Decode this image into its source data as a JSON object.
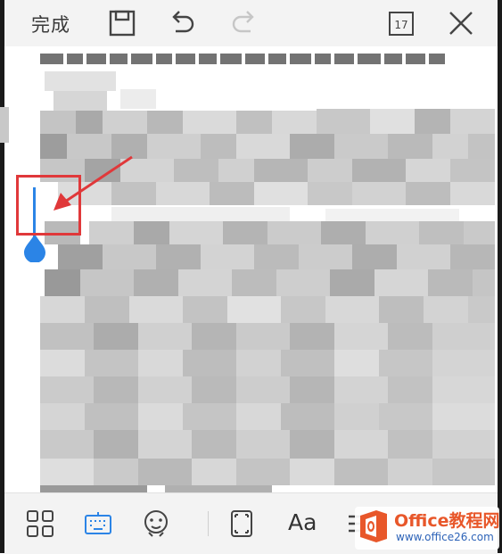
{
  "toolbar": {
    "done_label": "完成",
    "calendar_day": "17",
    "icons": [
      "save-icon",
      "undo-icon",
      "redo-icon",
      "calendar-icon",
      "close-icon"
    ]
  },
  "bottom_toolbar": {
    "icons": [
      "grid-icon",
      "keyboard-icon",
      "emoji-icon",
      "frame-icon",
      "font-icon",
      "list-icon"
    ],
    "font_label": "Aa",
    "active_color": "#2b84e6"
  },
  "document": {
    "cursor_color": "#2b84e6",
    "highlight_color": "#e0383a"
  },
  "watermark": {
    "title": "Office教程网",
    "url": "www.office26.com"
  }
}
